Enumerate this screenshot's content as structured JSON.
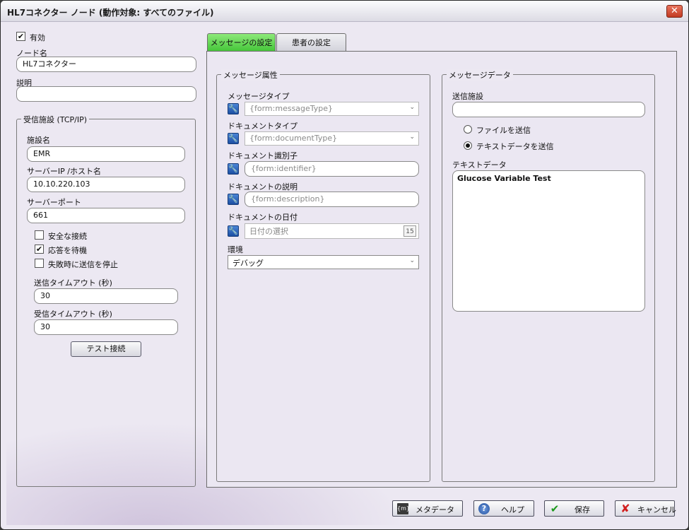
{
  "window": {
    "title": "HL7コネクター ノード (動作対象: すべてのファイル)",
    "close_glyph": "✕"
  },
  "left": {
    "enabled_label": "有効",
    "enabled_checked": true,
    "node_name_label": "ノード名",
    "node_name_value": "HL7コネクター",
    "description_label": "説明",
    "description_value": "",
    "receive_group": {
      "title": "受信施設 (TCP/IP)",
      "facility_label": "施設名",
      "facility_value": "EMR",
      "server_ip_label": "サーバーIP /ホスト名",
      "server_ip_value": "10.10.220.103",
      "server_port_label": "サーバーポート",
      "server_port_value": "661",
      "secure_label": "安全な接続",
      "secure_checked": false,
      "wait_label": "応答を待機",
      "wait_checked": true,
      "stop_label": "失敗時に送信を停止",
      "stop_checked": false,
      "send_timeout_label": "送信タイムアウト (秒)",
      "send_timeout_value": "30",
      "recv_timeout_label": "受信タイムアウト (秒)",
      "recv_timeout_value": "30",
      "test_button": "テスト接続"
    }
  },
  "tabs": [
    {
      "label": "メッセージの設定",
      "active": true
    },
    {
      "label": "患者の設定",
      "active": false
    }
  ],
  "message_attrs": {
    "title": "メッセージ属性",
    "message_type_label": "メッセージタイプ",
    "message_type_value": "{form:messageType}",
    "document_type_label": "ドキュメントタイプ",
    "document_type_value": "{form:documentType}",
    "document_id_label": "ドキュメント識別子",
    "document_id_value": "{form:identifier}",
    "document_desc_label": "ドキュメントの説明",
    "document_desc_value": "{form:description}",
    "document_date_label": "ドキュメントの日付",
    "document_date_placeholder": "日付の選択",
    "calendar_day": "15",
    "environment_label": "環境",
    "environment_value": "デバッグ"
  },
  "message_data": {
    "title": "メッセージデータ",
    "sending_facility_label": "送信施設",
    "sending_facility_value": "",
    "send_file_label": "ファイルを送信",
    "send_text_label": "テキストデータを送信",
    "selected_mode": "text",
    "text_data_label": "テキストデータ",
    "text_data_value": "Glucose Variable Test"
  },
  "footer": {
    "metadata": "メタデータ",
    "help": "ヘルプ",
    "save": "保存",
    "cancel": "キャンセル"
  },
  "colors": {
    "active_tab": "#46c63a",
    "wrench_icon": "#1c4fa3",
    "cancel_icon": "#d11f1f",
    "save_icon": "#1d9a1d"
  }
}
